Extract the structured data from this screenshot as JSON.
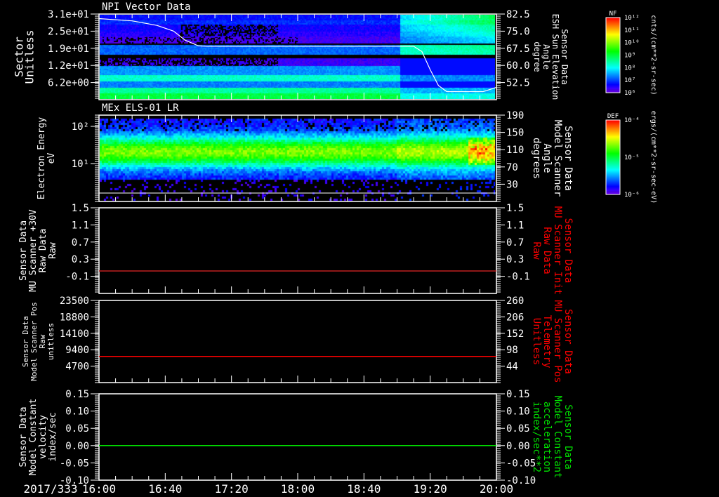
{
  "date_label": "2017/333",
  "x_ticks": [
    "16:00",
    "16:40",
    "17:20",
    "18:00",
    "18:40",
    "19:20",
    "20:00"
  ],
  "colors": {
    "background": "#000000",
    "axis": "#ffffff",
    "red_series": "#ff0000",
    "green_series": "#00e000",
    "sun_line": "#ffffff"
  },
  "panels": [
    {
      "title": "NPI Vector Data",
      "left_label": [
        "Sector",
        "Unitless"
      ],
      "left_ticks": [
        "3.1e+01",
        "2.5e+01",
        "1.9e+01",
        "1.2e+01",
        "6.2e+00"
      ],
      "right_label": [
        "Sensor Data",
        "ESH Sun Elevation",
        "Angle",
        "degree"
      ],
      "right_ticks": [
        "82.5",
        "75.0",
        "67.5",
        "60.0",
        "52.5"
      ],
      "colorbar": {
        "title": "NF",
        "ticks": [
          "10¹²",
          "10¹¹",
          "10¹⁰",
          "10⁹",
          "10⁸",
          "10⁷",
          "10⁶"
        ],
        "unit": "cnts/(cm**2-sr-sec)"
      }
    },
    {
      "title": "MEx ELS-01 LR",
      "left_label": [
        "Electron Energy",
        "eV"
      ],
      "left_ticks": [
        "10²",
        "10¹"
      ],
      "right_label": [
        "Sensor Data",
        "Model Scanner",
        "Angle",
        "degrees"
      ],
      "right_ticks": [
        "190",
        "150",
        "110",
        "70",
        "30"
      ],
      "colorbar": {
        "title": "DEF",
        "ticks": [
          "10⁻⁴",
          "10⁻⁵",
          "10⁻⁶"
        ],
        "unit": "ergs/(cm**2-sr-sec-eV)"
      }
    },
    {
      "left_label": [
        "Sensor Data",
        "MU Scanner +30V",
        "Raw Data",
        "Raw"
      ],
      "left_ticks": [
        "1.5",
        "1.1",
        "0.7",
        "0.3",
        "-0.1"
      ],
      "right_label": [
        "Sensor Data",
        "MU Scanner Init",
        "Raw Data",
        "Raw"
      ],
      "right_ticks": [
        "1.5",
        "1.1",
        "0.7",
        "0.3",
        "-0.1"
      ]
    },
    {
      "left_label": [
        "Sensor Data",
        "Model Scanner Pos",
        "Raw",
        "unitless"
      ],
      "left_ticks": [
        "23500",
        "18800",
        "14100",
        "9400",
        "4700"
      ],
      "right_label": [
        "Sensor Data",
        "MU Scanner Pos",
        "Telemetry",
        "Unitless"
      ],
      "right_ticks": [
        "260",
        "206",
        "152",
        "98",
        "44"
      ]
    },
    {
      "left_label": [
        "Sensor Data",
        "Model Constant",
        "velocity",
        "index/sec"
      ],
      "left_ticks": [
        "0.15",
        "0.10",
        "0.05",
        "0.00",
        "-0.05",
        "-0.10"
      ],
      "right_label": [
        "Sensor Data",
        "Model Constant",
        "acceleration",
        "index/sec**2"
      ],
      "right_ticks": [
        "0.15",
        "0.10",
        "0.05",
        "0.00",
        "-0.05",
        "-0.10"
      ]
    }
  ],
  "chart_data": [
    {
      "type": "heatmap",
      "title": "NPI Vector Data",
      "xlim": [
        "16:00",
        "20:00"
      ],
      "ylabel": "Sector Unitless",
      "ylim": [
        0,
        31
      ],
      "colorbar": {
        "label": "NF",
        "scale": "log",
        "range": [
          1000000.0,
          1000000000000.0
        ],
        "unit": "cnts/(cm**2-sr-sec)"
      },
      "overlay_line": {
        "name": "ESH Sun Elevation Angle",
        "axis": "right",
        "ylim": [
          45,
          82.5
        ],
        "points": [
          [
            "16:00",
            80.5
          ],
          [
            "16:20",
            79.5
          ],
          [
            "16:35",
            77.5
          ],
          [
            "16:45",
            75
          ],
          [
            "16:52",
            71
          ],
          [
            "17:00",
            68.5
          ],
          [
            "17:05",
            68.3
          ],
          [
            "19:10",
            68.3
          ],
          [
            "19:15",
            66
          ],
          [
            "19:20",
            58
          ],
          [
            "19:25",
            51
          ],
          [
            "19:30",
            48.3
          ],
          [
            "19:52",
            48.3
          ],
          [
            "20:00",
            50.2
          ]
        ]
      }
    },
    {
      "type": "heatmap",
      "title": "MEx ELS-01 LR",
      "xlim": [
        "16:00",
        "20:00"
      ],
      "ylabel": "Electron Energy eV",
      "yscale": "log",
      "colorbar": {
        "label": "DEF",
        "scale": "log",
        "range": [
          1e-06,
          0.0001
        ],
        "unit": "ergs/(cm**2-sr-sec-eV)"
      }
    },
    {
      "type": "line",
      "xlim": [
        "16:00",
        "20:00"
      ],
      "ylim": [
        -0.2,
        1.5
      ],
      "series": [
        {
          "color": "#c02020",
          "points": [
            [
              "16:00",
              0.0
            ],
            [
              "20:00",
              0.0
            ]
          ]
        }
      ]
    },
    {
      "type": "line",
      "xlim": [
        "16:00",
        "20:00"
      ],
      "ylim": [
        0,
        23500
      ],
      "series": [
        {
          "color": "#ff0000",
          "points": [
            [
              "16:00",
              8200
            ],
            [
              "20:00",
              8200
            ]
          ]
        }
      ]
    },
    {
      "type": "line",
      "xlim": [
        "16:00",
        "20:00"
      ],
      "ylim": [
        -0.1,
        0.15
      ],
      "series": [
        {
          "color": "#00e000",
          "points": [
            [
              "16:00",
              0.0
            ],
            [
              "20:00",
              0.0
            ]
          ]
        }
      ]
    }
  ]
}
